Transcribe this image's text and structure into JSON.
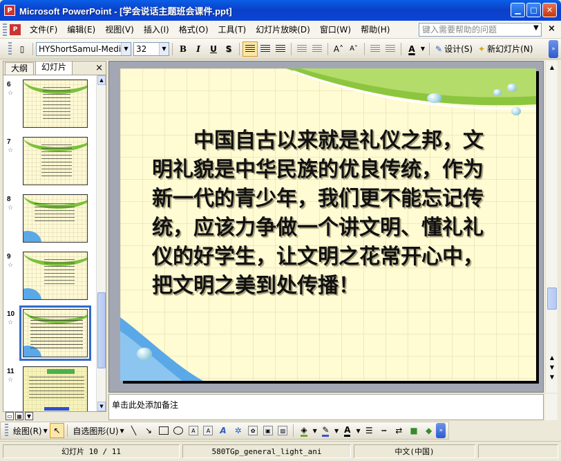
{
  "window": {
    "title": "Microsoft PowerPoint - [学会说话主题班会课件.ppt]",
    "app_icon": "powerpoint-icon",
    "buttons": [
      "minimize",
      "maximize",
      "close"
    ]
  },
  "menu": {
    "items": [
      "文件(F)",
      "编辑(E)",
      "视图(V)",
      "插入(I)",
      "格式(O)",
      "工具(T)",
      "幻灯片放映(D)",
      "窗口(W)",
      "帮助(H)"
    ],
    "help_placeholder": "键入需要帮助的问题",
    "close_glyph": "×"
  },
  "format_toolbar": {
    "font_name": "HYShortSamul-Mediu",
    "font_size": "32",
    "bold": "B",
    "italic": "I",
    "underline": "U",
    "shadow": "S",
    "design_label": "设计(S)",
    "new_slide_label": "新幻灯片(N)"
  },
  "left_pane": {
    "tabs": [
      "大纲",
      "幻灯片"
    ],
    "active_tab": "幻灯片",
    "close_glyph": "×",
    "slides": [
      {
        "number": "6",
        "star": "☆"
      },
      {
        "number": "7",
        "star": "☆"
      },
      {
        "number": "8",
        "star": "☆"
      },
      {
        "number": "9",
        "star": "☆"
      },
      {
        "number": "10",
        "star": "☆",
        "selected": true
      },
      {
        "number": "11",
        "star": "☆"
      }
    ]
  },
  "slide": {
    "body": "中国自古以来就是礼仪之邦，文明礼貌是中华民族的优良传统，作为新一代的青少年，我们更不能忘记传统，应该力争做一个讲文明、懂礼礼仪的好学生，让文明之花常开心中，把文明之美到处传播！"
  },
  "notes": {
    "placeholder": "单击此处添加备注"
  },
  "draw_toolbar": {
    "draw_label": "绘图(R)",
    "autoshapes_label": "自选图形(U)"
  },
  "status": {
    "slide_counter": "幻灯片 10 / 11",
    "design_name": "580TGp_general_light_ani",
    "language": "中文(中国)"
  },
  "colors": {
    "title_bar": "#0a46d8",
    "slide_background": "#fffbd2",
    "swoosh_green": "#7ac23a",
    "corner_blue": "#5aa8e8",
    "selection_blue": "#316ac5"
  }
}
